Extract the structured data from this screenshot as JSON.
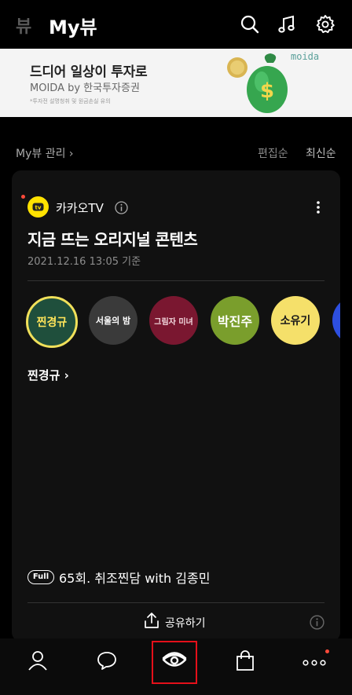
{
  "header": {
    "prev_tab": "뷰",
    "active_tab": "My뷰",
    "icons": [
      "search-icon",
      "music-icon",
      "settings-icon"
    ]
  },
  "banner": {
    "title": "드디어 일상이 투자로",
    "subtitle": "MOIDA by 한국투자증권",
    "note": "*투자전 설명청취 및 원금손실 유의",
    "brand": "moida"
  },
  "manage": {
    "label": "My뷰 관리 ›",
    "sort_edit": "편집순",
    "sort_latest": "최신순"
  },
  "card": {
    "channel_badge": "tv",
    "channel": "카카오TV",
    "title": "지금 뜨는 오리지널 콘텐츠",
    "date": "2021.12.16 13:05 기준",
    "circles": [
      {
        "label": "찐경규",
        "bg": "#1f4f3c",
        "fg": "#ffe55a"
      },
      {
        "label": "서울의 밤",
        "bg": "#3a3a3a",
        "fg": "#ffffff"
      },
      {
        "label": "그림자 미녀",
        "bg": "#7a1730",
        "fg": "#f3d9df"
      },
      {
        "label": "박진주",
        "bg": "#7a9e2c",
        "fg": "#ffffff"
      },
      {
        "label": "소유기",
        "bg": "#f5e06a",
        "fg": "#1a1a1a"
      },
      {
        "label": "",
        "bg": "#2d4fe0",
        "fg": "#ffffff"
      }
    ],
    "section_label": "찐경규 ›",
    "full_badge": "Full",
    "episode": "65회. 취조찐담 with 김종민",
    "share": "공유하기"
  },
  "nav": {
    "items": [
      "profile-icon",
      "chat-icon",
      "view-icon",
      "shopping-icon",
      "more-icon"
    ]
  },
  "colors": {
    "kakao_yellow": "#ffe200",
    "highlight_red": "#e5101a",
    "notification_dot": "#ff4a3a"
  }
}
